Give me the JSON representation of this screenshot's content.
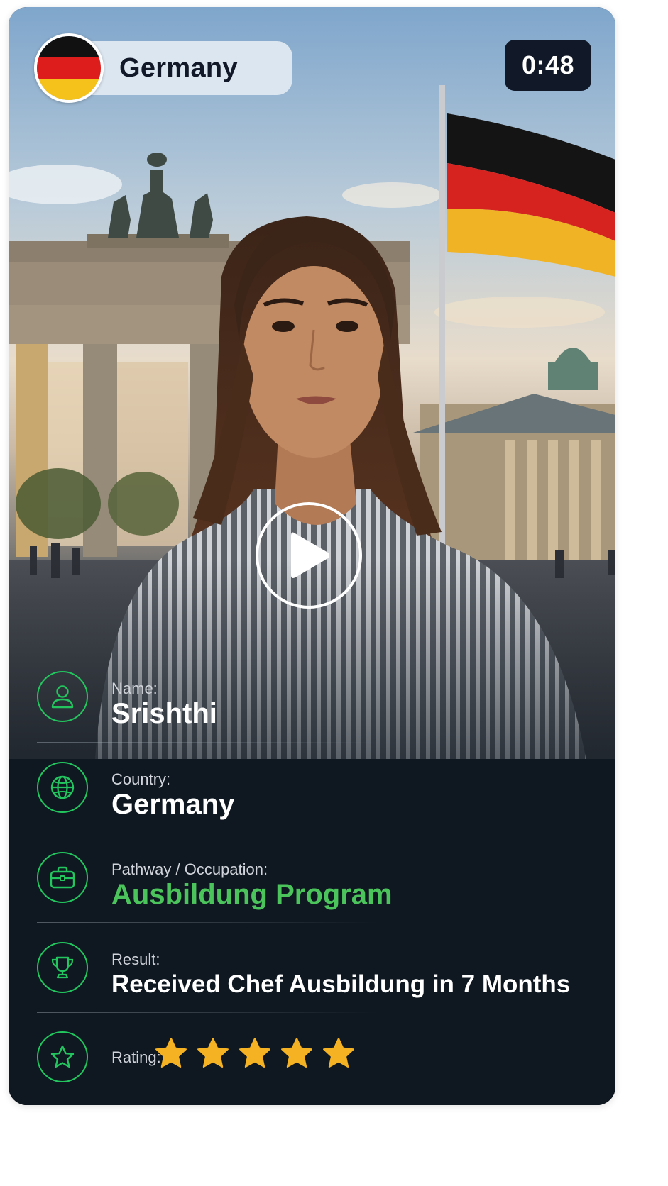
{
  "header": {
    "country_pill": "Germany",
    "flag_icon": "germany-flag-icon",
    "timer": "0:48"
  },
  "video": {
    "play_icon": "play-icon"
  },
  "profile": {
    "name_label": "Name:",
    "name_value": "Srishthi",
    "country_label": "Country:",
    "country_value": "Germany",
    "pathway_label": "Pathway /  Occupation:",
    "pathway_value": "Ausbildung Program",
    "result_label": "Result:",
    "result_value": "Received Chef Ausbildung in 7 Months",
    "rating_label": "Rating:",
    "rating_stars": 5,
    "rating_max": 5
  },
  "icons": {
    "name": "user-icon",
    "country": "globe-icon",
    "pathway": "briefcase-icon",
    "result": "trophy-icon",
    "rating": "star-outline-icon"
  },
  "colors": {
    "accent_green": "#4cc45c",
    "icon_green": "#22c55e",
    "star_gold": "#f5b324",
    "card_dark": "#0f1720",
    "flag_black": "#111111",
    "flag_red": "#dd1c1c",
    "flag_gold": "#f4c21b"
  }
}
